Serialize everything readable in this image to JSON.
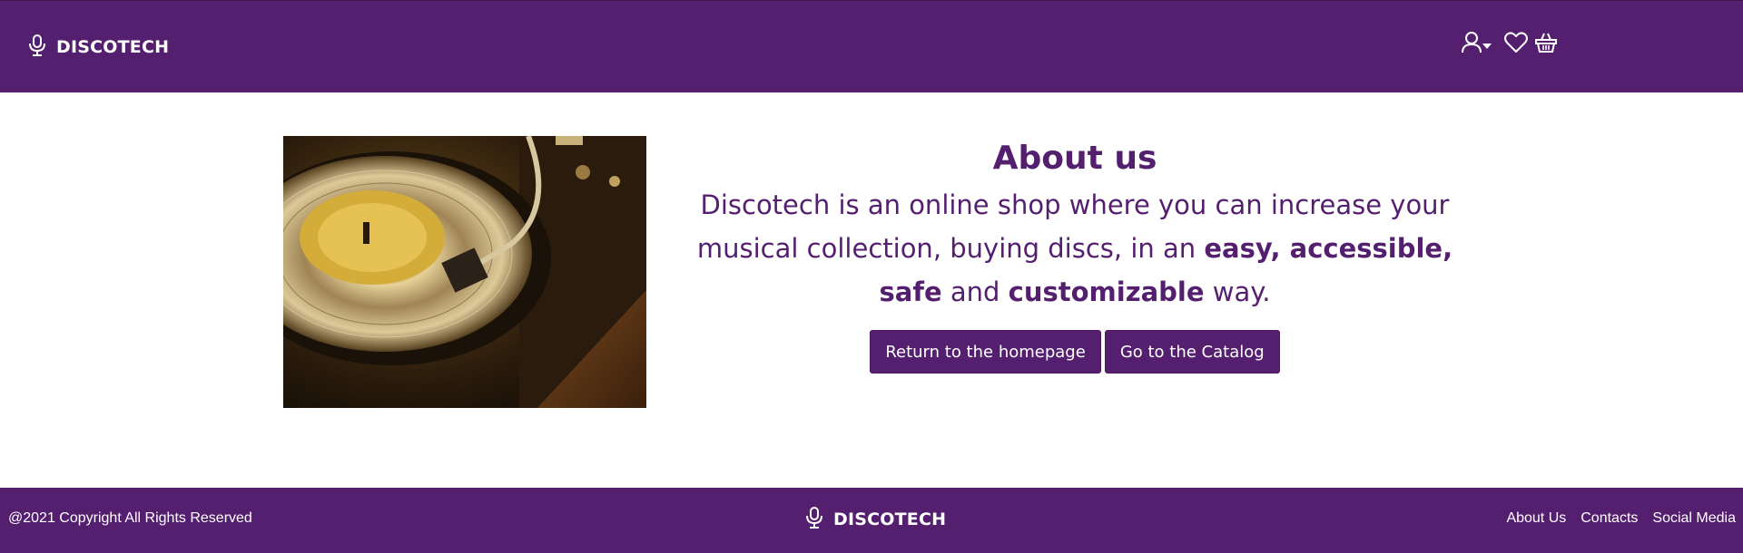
{
  "header": {
    "brand": "DISCOTECH",
    "icons": [
      "microphone-icon",
      "user-icon",
      "caret-down-icon",
      "heart-icon",
      "basket-icon"
    ]
  },
  "main": {
    "image_label": "turntable-vinyl-record",
    "title": "About us",
    "description": {
      "part1": "Discotech is an online shop where you can increase your musical collection, buying discs, in an ",
      "bold1": "easy, accessible, safe",
      "part2": " and ",
      "bold2": "customizable",
      "part3": " way."
    },
    "buttons": {
      "home": "Return to the homepage",
      "catalog": "Go to the Catalog"
    }
  },
  "footer": {
    "copyright": "@2021 Copyright All Rights Reserved",
    "brand": "DISCOTECH",
    "links": [
      "About Us",
      "Contacts",
      "Social Media"
    ]
  },
  "colors": {
    "brand_purple": "#541f6e",
    "text_white": "#ffffff"
  }
}
